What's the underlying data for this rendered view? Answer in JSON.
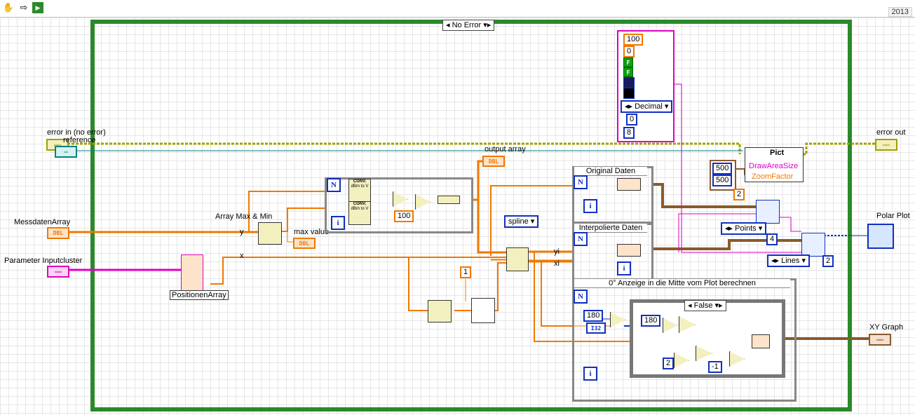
{
  "version": "2013",
  "case_structure": {
    "selector": "No Error"
  },
  "inner_case": {
    "selector": "False"
  },
  "controls": {
    "error_in": "error in (no error)",
    "reference": "reference",
    "messdaten": "MessdatenArray",
    "parameter": "Parameter Inputcluster"
  },
  "indicators": {
    "error_out": "error out",
    "polar_plot": "Polar Plot",
    "xy_graph": "XY Graph"
  },
  "labels": {
    "array_maxmin": "Array Max & Min",
    "max_value": "max value",
    "output_array": "output array",
    "positionen": "PositionenArray",
    "x": "x",
    "y": "y",
    "yi": "yi",
    "xi": "xi",
    "conv1": "CONV.",
    "conv1b": "dBm to V",
    "conv2": "CONV.",
    "conv2b": "dBm to V"
  },
  "constants": {
    "c100": "100",
    "c1": "1",
    "c100top": "100",
    "c0top": "0",
    "cF1": "F",
    "cF2": "F",
    "decimal": "Decimal",
    "c0b": "0",
    "c8": "8",
    "c500a": "500",
    "c500b": "500",
    "c2a": "2",
    "c4": "4",
    "c2b": "2",
    "c180a": "180",
    "c180b": "180",
    "c2c": "2",
    "cm1": "-1",
    "i32": "I32",
    "points": "Points",
    "lines": "Lines",
    "spline": "spline",
    "dbl": "DBL"
  },
  "frames": {
    "original": "Original Daten",
    "interpolierte": "Interpolierte Daten",
    "anzeige": "0° Anzeige in die Mitte vom Plot berechnen"
  },
  "pict": {
    "title": "Pict",
    "draw_area": "DrawAreaSize",
    "zoom": "ZoomFactor"
  },
  "colors": {
    "orange_wire": "#f07800",
    "pink_wire": "#e000c0",
    "error_wire": "#a0a000",
    "blue_wire": "#1030c0",
    "brown_wire": "#8a5a2b",
    "teal_wire": "#008080",
    "case_border": "#2a8a2a"
  }
}
